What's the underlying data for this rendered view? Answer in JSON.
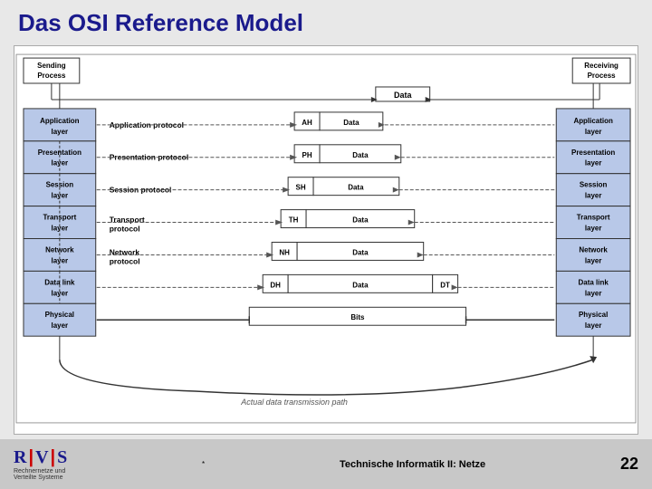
{
  "title": "Das OSI Reference Model",
  "sending_process": "Sending\nProcess",
  "receiving_process": "Receiving\nProcess",
  "layers_left": [
    "Application\nlayer",
    "Presentation\nlayer",
    "Session\nlayer",
    "Transport\nlayer",
    "Network\nlayer",
    "Data link\nlayer",
    "Physical\nlayer"
  ],
  "layers_right": [
    "Application\nlayer",
    "Presentation\nlayer",
    "Session\nlayer",
    "Transport\nlayer",
    "Network\nlayer",
    "Data link\nlayer",
    "Physical\nlayer"
  ],
  "protocols": [
    "Application protocol",
    "Presentation protocol",
    "Session protocol",
    "Transport\nprotocol",
    "Network\nprotocol",
    ""
  ],
  "headers": [
    "AH",
    "PH",
    "SH",
    "TH",
    "NH",
    "DH"
  ],
  "trailers": [
    "DT"
  ],
  "data_label": "Data",
  "bits_label": "Bits",
  "actual_transmission": "Actual data transmission path",
  "footer_logo": "R|V|S",
  "footer_sub1": "Rechnernetze und",
  "footer_sub2": "Verteilte Systeme",
  "footer_course": "Technische Informatik II: Netze",
  "footer_page": "22"
}
